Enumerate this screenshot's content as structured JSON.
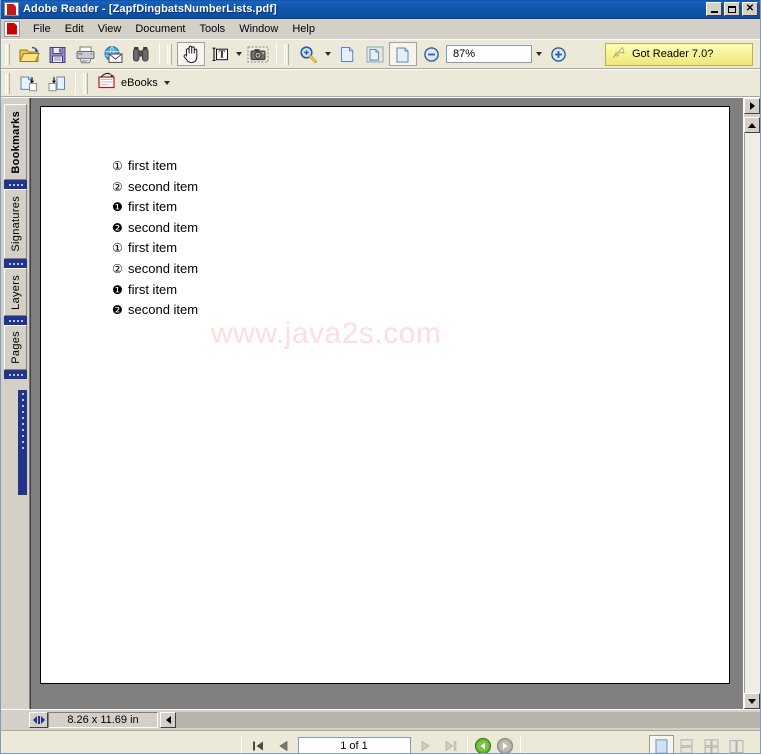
{
  "window": {
    "title": "Adobe Reader - [ZapfDingbatsNumberLists.pdf]",
    "app_icon": "adobe-reader-icon",
    "minimize_label": "_",
    "maximize_label": "□",
    "close_label": "X"
  },
  "menubar": {
    "logo_icon": "adobe-pdf-logo-icon",
    "items": [
      {
        "label": "File"
      },
      {
        "label": "Edit"
      },
      {
        "label": "View"
      },
      {
        "label": "Document"
      },
      {
        "label": "Tools"
      },
      {
        "label": "Window"
      },
      {
        "label": "Help"
      }
    ]
  },
  "toolbar_main": {
    "buttons": [
      {
        "name": "open-file-icon",
        "title": "Open"
      },
      {
        "name": "save-file-icon",
        "title": "Save a Copy"
      },
      {
        "name": "print-icon",
        "title": "Print"
      },
      {
        "name": "email-icon",
        "title": "Email"
      },
      {
        "name": "search-binoculars-icon",
        "title": "Search"
      },
      {
        "name": "hand-tool-icon",
        "title": "Hand Tool"
      },
      {
        "name": "select-text-icon",
        "title": "Select Text"
      },
      {
        "name": "snapshot-camera-icon",
        "title": "Snapshot Tool"
      },
      {
        "name": "zoom-in-magnifier-icon",
        "title": "Zoom In Tool"
      }
    ],
    "zoom_value": "87%",
    "zoom_out_icon": "zoom-out-icon",
    "zoom_in_icon": "zoom-in-icon",
    "view_icons": [
      {
        "name": "actual-size-icon"
      },
      {
        "name": "fit-page-icon"
      },
      {
        "name": "fit-width-icon"
      }
    ],
    "promo": {
      "label": "Got Reader 7.0?",
      "icon": "arrow-cursor-icon",
      "bg_color": "#f6f292",
      "border_color": "#b9b04a"
    }
  },
  "toolbar_second": {
    "buttons": [
      {
        "name": "previous-view-icon"
      },
      {
        "name": "next-view-icon"
      }
    ],
    "ebooks": {
      "label": "eBooks",
      "icon": "ebooks-icon"
    }
  },
  "sidebar": {
    "tabs": [
      {
        "label": "Bookmarks",
        "active": true
      },
      {
        "label": "Signatures",
        "active": false
      },
      {
        "label": "Layers",
        "active": false
      },
      {
        "label": "Pages",
        "active": false
      }
    ]
  },
  "document": {
    "watermark": "www.java2s.com",
    "items": [
      {
        "bullet": "①",
        "text": "first item"
      },
      {
        "bullet": "②",
        "text": "second item"
      },
      {
        "bullet": "❶",
        "text": "first item"
      },
      {
        "bullet": "❷",
        "text": "second item"
      },
      {
        "bullet": "①",
        "text": "first item"
      },
      {
        "bullet": "②",
        "text": "second item"
      },
      {
        "bullet": "❶",
        "text": "first item"
      },
      {
        "bullet": "❷",
        "text": "second item"
      }
    ]
  },
  "statusbar": {
    "page_size": "8.26 x 11.69 in",
    "resize_grip_icon": "resize-grip-icon",
    "scroll_left_icon": "scroll-left-icon"
  },
  "navbar": {
    "first_page_icon": "first-page-icon",
    "previous_page_icon": "previous-page-icon",
    "page_indicator": "1 of 1",
    "next_page_icon": "next-page-icon",
    "last_page_icon": "last-page-icon",
    "go_back_icon": "go-back-icon",
    "go_forward_icon": "go-forward-icon",
    "layout_buttons": [
      {
        "name": "single-page-layout-icon",
        "selected": true
      },
      {
        "name": "continuous-layout-icon",
        "selected": false
      },
      {
        "name": "facing-layout-icon",
        "selected": false
      },
      {
        "name": "continuous-facing-layout-icon",
        "selected": false
      }
    ]
  },
  "scrollbar": {
    "expand_icon": "expand-right-icon",
    "up_icon": "scroll-up-icon",
    "down_icon": "scroll-down-icon"
  }
}
